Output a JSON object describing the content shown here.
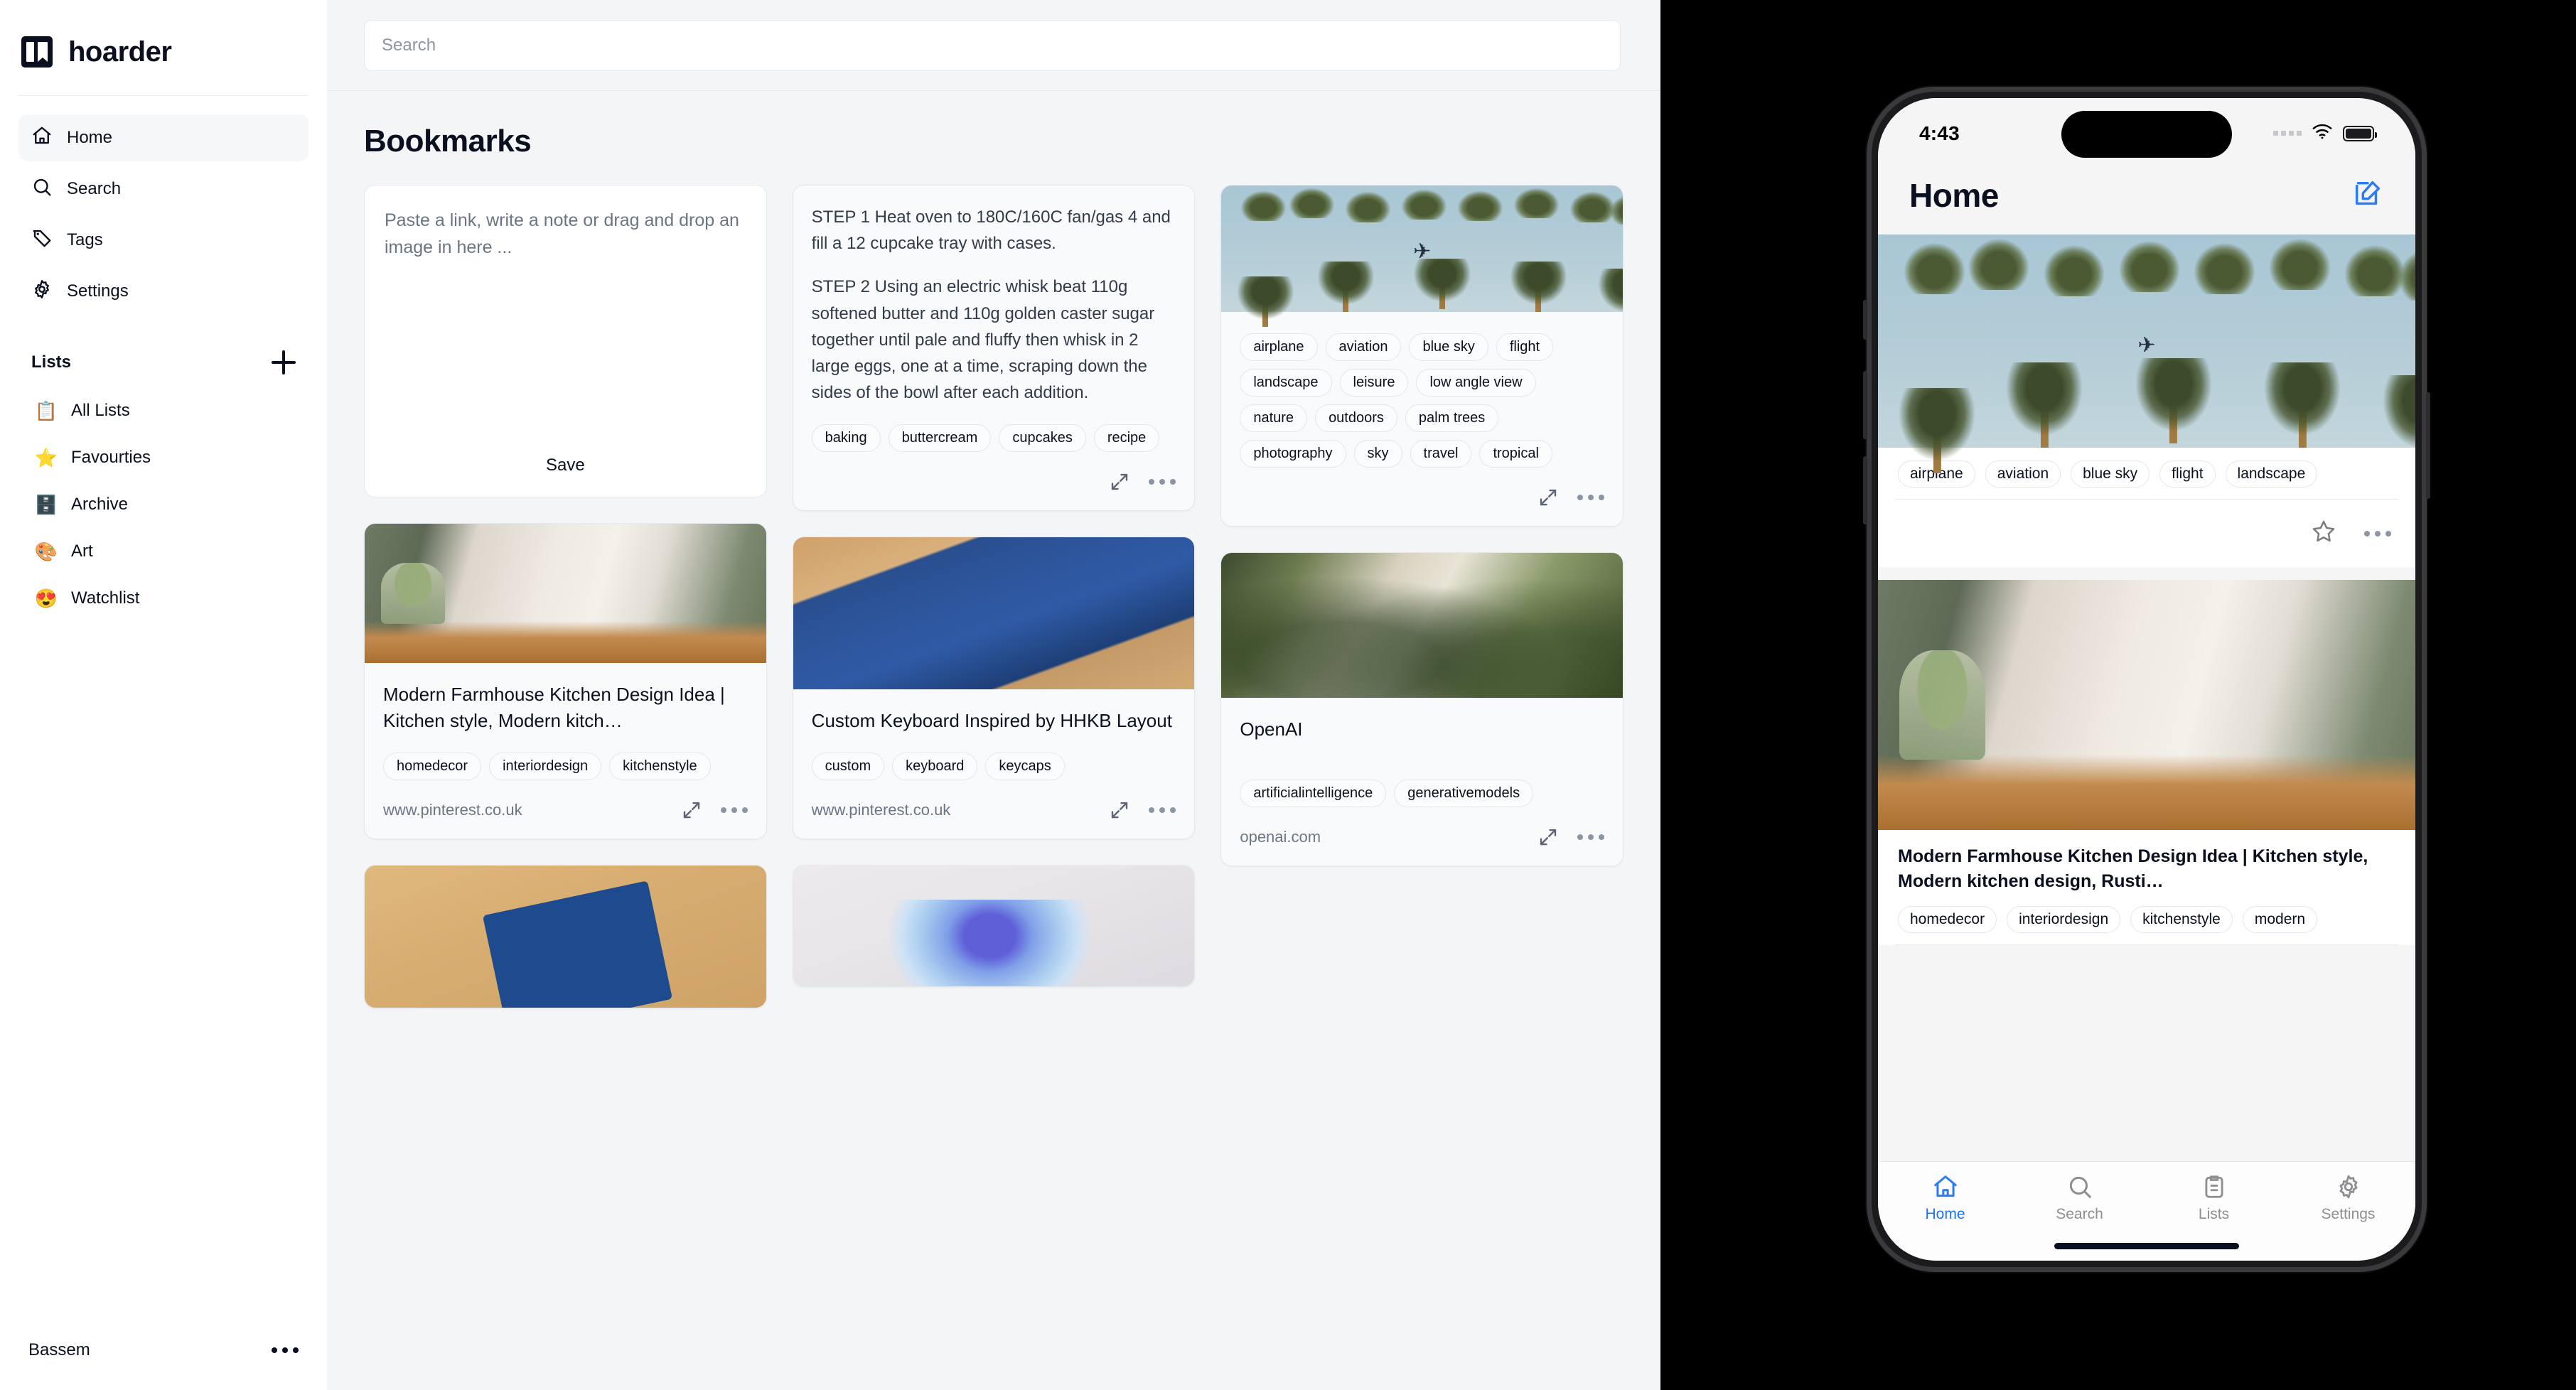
{
  "brand": {
    "name": "hoarder"
  },
  "sidebar": {
    "nav": [
      {
        "label": "Home",
        "icon": "home-icon",
        "active": true
      },
      {
        "label": "Search",
        "icon": "search-icon",
        "active": false
      },
      {
        "label": "Tags",
        "icon": "tag-icon",
        "active": false
      },
      {
        "label": "Settings",
        "icon": "gear-icon",
        "active": false
      }
    ],
    "lists_title": "Lists",
    "add_list_label": "+",
    "lists": [
      {
        "emoji": "📋",
        "label": "All Lists"
      },
      {
        "emoji": "⭐",
        "label": "Favourties"
      },
      {
        "emoji": "🗄️",
        "label": "Archive"
      },
      {
        "emoji": "🎨",
        "label": "Art"
      },
      {
        "emoji": "😍",
        "label": "Watchlist"
      }
    ],
    "user": {
      "name": "Bassem",
      "menu_label": "more-options"
    }
  },
  "main": {
    "search": {
      "placeholder": "Search",
      "value": ""
    },
    "page_title": "Bookmarks",
    "editor": {
      "placeholder": "Paste a link, write a note or drag and drop an image in here ...",
      "save_label": "Save"
    },
    "cards": [
      {
        "id": "recipe-note",
        "kind": "note",
        "paragraphs": [
          "STEP 1 Heat oven to 180C/160C fan/gas 4 and fill a 12 cupcake tray with cases.",
          "STEP 2 Using an electric whisk beat 110g softened butter and 110g golden caster sugar together until pale and fluffy then whisk in 2 large eggs, one at a time, scraping down the sides of the bowl after each addition."
        ],
        "tags": [
          "baking",
          "buttercream",
          "cupcakes",
          "recipe"
        ],
        "url": ""
      },
      {
        "id": "palm-trees",
        "kind": "image",
        "image_alt": "palm trees low angle view with airplane",
        "title": "",
        "tags": [
          "airplane",
          "aviation",
          "blue sky",
          "flight",
          "landscape",
          "leisure",
          "low angle view",
          "nature",
          "outdoors",
          "palm trees",
          "photography",
          "sky",
          "travel",
          "tropical"
        ],
        "url": ""
      },
      {
        "id": "kitchen",
        "kind": "image",
        "image_alt": "modern farmhouse kitchen",
        "title": "Modern Farmhouse Kitchen Design Idea | Kitchen style, Modern kitch…",
        "tags": [
          "homedecor",
          "interiordesign",
          "kitchenstyle"
        ],
        "url": "www.pinterest.co.uk"
      },
      {
        "id": "keyboard",
        "kind": "image",
        "image_alt": "blue custom mechanical keyboard",
        "title": "Custom Keyboard Inspired by HHKB Layout",
        "tags": [
          "custom",
          "keyboard",
          "keycaps"
        ],
        "url": "www.pinterest.co.uk"
      },
      {
        "id": "openai",
        "kind": "image",
        "image_alt": "people talking among plants",
        "title": "OpenAI",
        "tags": [
          "artificialintelligence",
          "generativemodels"
        ],
        "url": "openai.com"
      },
      {
        "id": "circuit-board",
        "kind": "image",
        "image_alt": "blue circuit board with fan on wood desk",
        "title": "",
        "tags": [],
        "url": ""
      },
      {
        "id": "crystal",
        "kind": "image",
        "image_alt": "blue crystal sculpture on wall",
        "title": "",
        "tags": [],
        "url": ""
      }
    ]
  },
  "phone": {
    "status": {
      "time": "4:43",
      "wifi": "wifi-icon",
      "battery": "battery-icon"
    },
    "header": {
      "title": "Home",
      "compose_label": "compose-icon",
      "accent": "#2a7bf6"
    },
    "cards": [
      {
        "id": "palm-trees",
        "image_alt": "palm trees low angle view with airplane",
        "title": "",
        "tags": [
          "airplane",
          "aviation",
          "blue sky",
          "flight",
          "landscape"
        ],
        "actions": [
          "favourite-star",
          "more-options"
        ]
      },
      {
        "id": "kitchen",
        "image_alt": "modern farmhouse kitchen",
        "title": "Modern Farmhouse Kitchen Design Idea | Kitchen style, Modern kitchen design, Rusti…",
        "tags": [
          "homedecor",
          "interiordesign",
          "kitchenstyle",
          "modern"
        ],
        "actions": []
      }
    ],
    "tabs": [
      {
        "label": "Home",
        "icon": "home-icon",
        "active": true
      },
      {
        "label": "Search",
        "icon": "search-icon",
        "active": false
      },
      {
        "label": "Lists",
        "icon": "clipboard-icon",
        "active": false
      },
      {
        "label": "Settings",
        "icon": "gear-icon",
        "active": false
      }
    ]
  },
  "colors": {
    "accent": "#2a7bf6",
    "surface": "#f8fafb",
    "page_bg": "#f3f5f7",
    "text": "#0b1020",
    "muted": "#6b7685"
  }
}
